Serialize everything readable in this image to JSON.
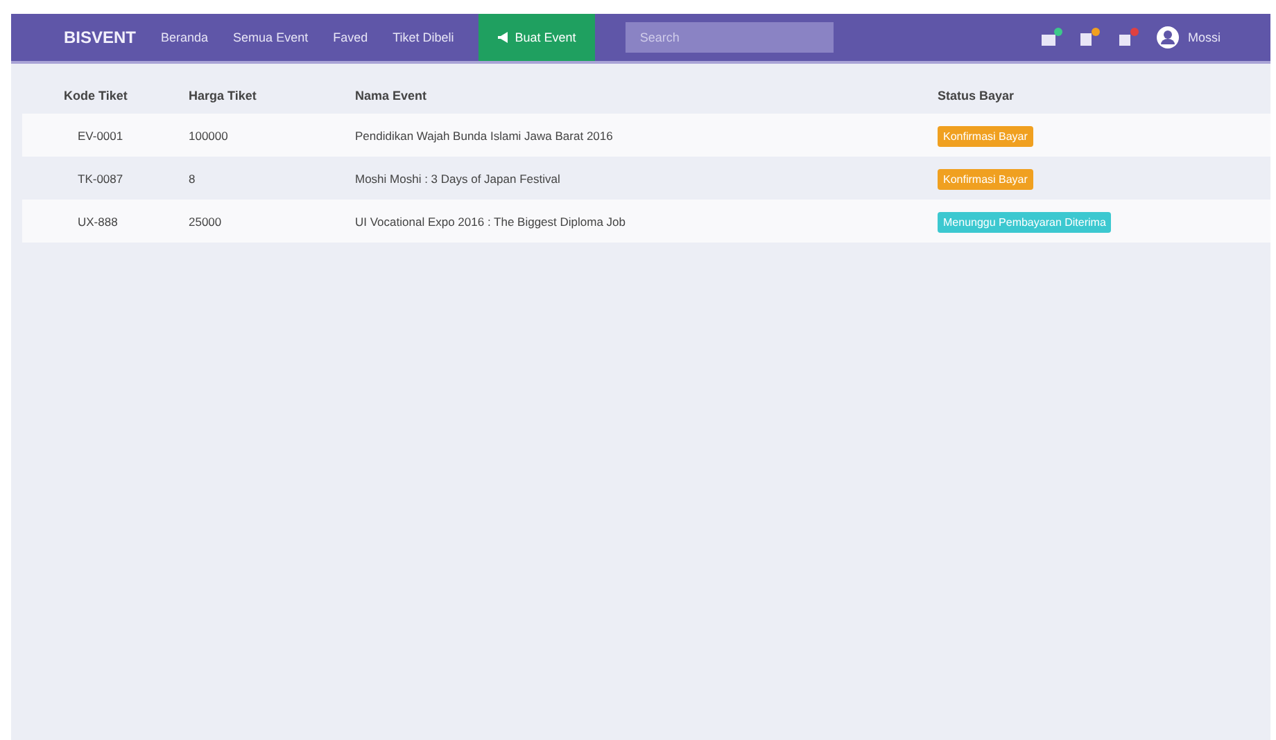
{
  "navbar": {
    "brand": "BISVENT",
    "links": [
      {
        "label": "Beranda",
        "selected": false
      },
      {
        "label": "Semua Event",
        "selected": false
      },
      {
        "label": "Faved",
        "selected": false
      },
      {
        "label": "Tiket Dibeli",
        "selected": false
      }
    ],
    "create_button": "Buat Event",
    "search": {
      "placeholder": "Search"
    },
    "user": "Mossi"
  },
  "table": {
    "columns": [
      "Kode Tiket",
      "Harga Tiket",
      "Nama Event",
      "Status Bayar"
    ],
    "rows": [
      {
        "code": "EV-0001",
        "price": "100000",
        "event": "Pendidikan Wajah Bunda Islami Jawa Barat 2016",
        "status": "Konfirmasi Bayar",
        "color": "#f0a020"
      },
      {
        "code": "TK-0087",
        "price": "8",
        "event": "Moshi Moshi : 3 Days of Japan Festival",
        "status": "Konfirmasi Bayar",
        "color": "#f0a020"
      },
      {
        "code": "UX-888",
        "price": "25000",
        "event": "UI Vocational Expo 2016 : The Biggest Diploma Job",
        "status": "Menunggu Pembayaran Diterima",
        "color": "#3cc8d0"
      }
    ]
  }
}
